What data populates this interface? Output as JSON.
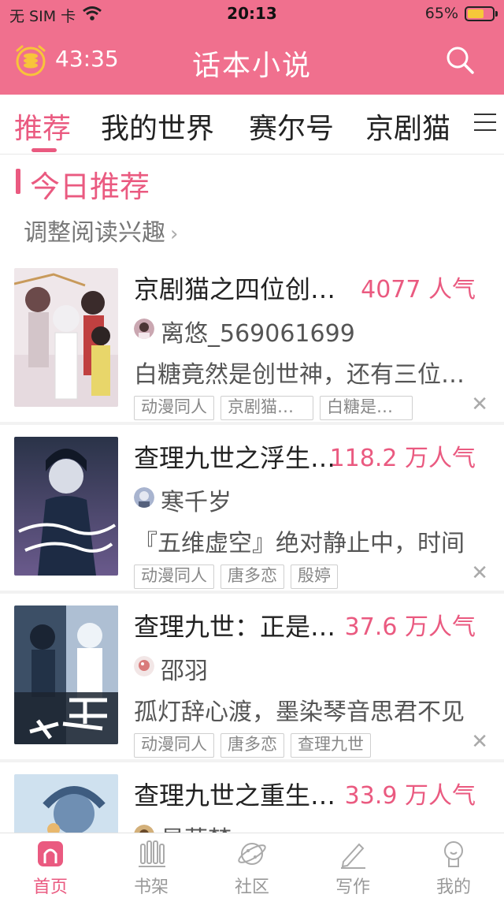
{
  "status_bar": {
    "carrier": "无 SIM 卡",
    "time": "20:13",
    "battery": "65%",
    "battery_level": 0.65
  },
  "header": {
    "timer": "43:35",
    "title": "话本小说",
    "timer_icon": "alarm-coin-icon",
    "search_icon": "search-icon"
  },
  "tabs": [
    {
      "label": "推荐",
      "active": true
    },
    {
      "label": "我的世界",
      "active": false
    },
    {
      "label": "赛尔号",
      "active": false
    },
    {
      "label": "京剧猫",
      "active": false
    }
  ],
  "section": {
    "title": "今日推荐",
    "subtitle": "调整阅读兴趣"
  },
  "feed": [
    {
      "title": "京剧猫之四位创世神",
      "popularity": "4077 人气",
      "author": "离悠_569061699",
      "description": "白糖竟然是创世神，还有三位创世神",
      "tags": [
        "动漫同人",
        "京剧猫之四位",
        "白糖是创世神"
      ]
    },
    {
      "title": "查理九世之浮生物语",
      "popularity": "118.2 万人气",
      "author": "寒千岁",
      "description": "『五维虚空』绝对静止中，时间",
      "tags": [
        "动漫同人",
        "唐多恋",
        "殷婷"
      ]
    },
    {
      "title": "查理九世：正是少年时",
      "popularity": "37.6 万人气",
      "author": "邵羽",
      "description": "孤灯辞心渡，墨染琴音思君不见",
      "tags": [
        "动漫同人",
        "唐多恋",
        "查理九世"
      ]
    },
    {
      "title": "查理九世之重生之路",
      "popularity": "33.9 万人气",
      "author": "星萤梦",
      "description": "",
      "tags": []
    }
  ],
  "bottom_nav": [
    {
      "label": "首页",
      "icon": "home-icon",
      "active": true
    },
    {
      "label": "书架",
      "icon": "bookshelf-icon",
      "active": false
    },
    {
      "label": "社区",
      "icon": "community-planet-icon",
      "active": false
    },
    {
      "label": "写作",
      "icon": "pen-write-icon",
      "active": false
    },
    {
      "label": "我的",
      "icon": "profile-icon",
      "active": false
    }
  ],
  "colors": {
    "brand": "#f0708e",
    "accent": "#ea5a80"
  }
}
